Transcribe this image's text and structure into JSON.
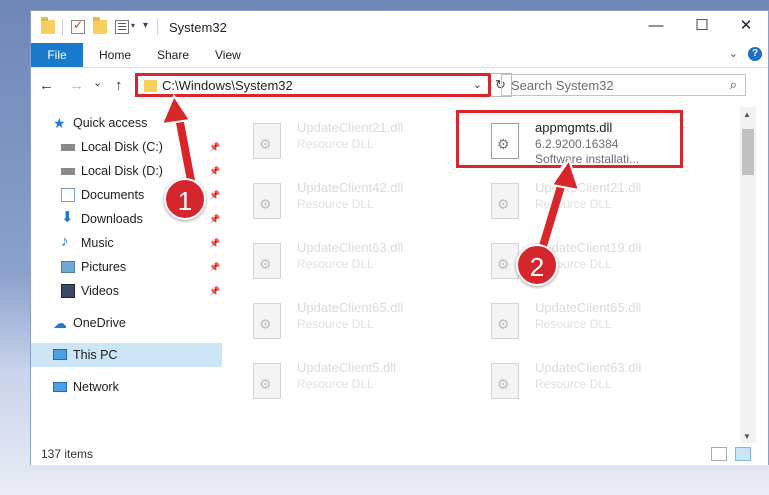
{
  "window": {
    "title": "System32",
    "controls": {
      "minimize": "—",
      "maximize": "☐",
      "close": "✕"
    }
  },
  "ribbon": {
    "tabs": [
      "File",
      "Home",
      "Share",
      "View"
    ],
    "expand_icon": "chevron-down-icon",
    "help_label": "?"
  },
  "nav": {
    "back_glyph": "←",
    "forward_glyph": "→",
    "recent_glyph": "⌄",
    "up_glyph": "↑",
    "address": "C:\\Windows\\System32",
    "address_dropdown": "⌄",
    "refresh_glyph": "↻",
    "search_placeholder": "Search System32",
    "search_glyph": "⌕"
  },
  "sidebar": {
    "quick_access": "Quick access",
    "items": [
      {
        "label": "Local Disk (C:)",
        "icon": "drive-icon",
        "pinned": true
      },
      {
        "label": "Local Disk (D:)",
        "icon": "drive-icon",
        "pinned": true
      },
      {
        "label": "Documents",
        "icon": "documents-icon",
        "pinned": true
      },
      {
        "label": "Downloads",
        "icon": "downloads-icon",
        "pinned": true
      },
      {
        "label": "Music",
        "icon": "music-icon",
        "pinned": true
      },
      {
        "label": "Pictures",
        "icon": "pictures-icon",
        "pinned": true
      },
      {
        "label": "Videos",
        "icon": "videos-icon",
        "pinned": true
      }
    ],
    "onedrive": "OneDrive",
    "this_pc": "This PC",
    "network": "Network"
  },
  "files": [
    {
      "name": "UpdateClient21.dll",
      "sub": "Resource DLL"
    },
    {
      "name": "appmgmts.dll",
      "sub": "6.2.9200.16384",
      "sub2": "Software installati..."
    },
    {
      "name": "UpdateClient42.dll",
      "sub": "Resource DLL"
    },
    {
      "name": "UpdateClient21.dll",
      "sub": "Resource DLL"
    },
    {
      "name": "UpdateClient63.dll",
      "sub": "Resource DLL"
    },
    {
      "name": "UpdateClient19.dll",
      "sub": "Resource DLL"
    },
    {
      "name": "UpdateClient65.dll",
      "sub": "Resource DLL"
    },
    {
      "name": "UpdateClient65.dll",
      "sub": "Resource DLL"
    },
    {
      "name": "UpdateClient5.dll",
      "sub": "Resource DLL"
    },
    {
      "name": "UpdateClient63.dll",
      "sub": "Resource DLL"
    }
  ],
  "status": {
    "item_count": "137 items"
  },
  "annotations": {
    "step1": "1",
    "step2": "2",
    "color": "#d9262b"
  }
}
